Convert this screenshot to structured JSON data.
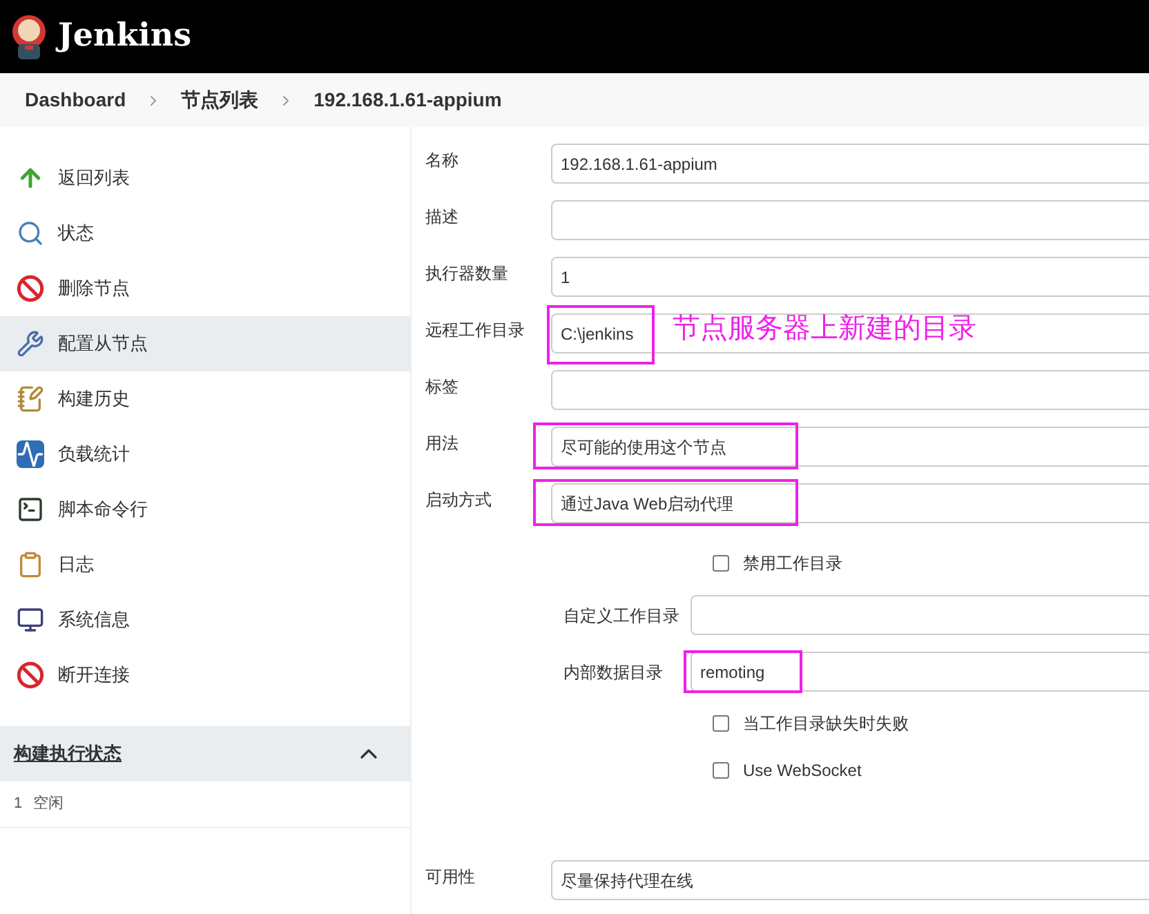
{
  "header": {
    "title": "Jenkins"
  },
  "breadcrumb": [
    "Dashboard",
    "节点列表",
    "192.168.1.61-appium"
  ],
  "sidebar": {
    "items": [
      {
        "label": "返回列表",
        "selected": false
      },
      {
        "label": "状态",
        "selected": false
      },
      {
        "label": "删除节点",
        "selected": false
      },
      {
        "label": "配置从节点",
        "selected": true
      },
      {
        "label": "构建历史",
        "selected": false
      },
      {
        "label": "负载统计",
        "selected": false
      },
      {
        "label": "脚本命令行",
        "selected": false
      },
      {
        "label": "日志",
        "selected": false
      },
      {
        "label": "系统信息",
        "selected": false
      },
      {
        "label": "断开连接",
        "selected": false
      }
    ],
    "executor_panel": {
      "title": "构建执行状态",
      "expanded": true,
      "rows": [
        {
          "number": "1",
          "status": "空闲"
        }
      ]
    }
  },
  "form": {
    "fields": [
      {
        "label": "名称",
        "value": "192.168.1.61-appium"
      },
      {
        "label": "描述"
      },
      {
        "label": "执行器数量",
        "value": "1"
      },
      {
        "label": "远程工作目录",
        "value": "C:\\jenkins",
        "highlighted": true,
        "annotation": "节点服务器上新建的目录"
      },
      {
        "label": "标签"
      },
      {
        "label": "用法",
        "value": "尽可能的使用这个节点",
        "highlighted": true
      },
      {
        "label": "启动方式",
        "value": "通过Java Web启动代理",
        "highlighted": true
      }
    ],
    "launch_options": [
      {
        "kind": "checkbox",
        "label": "禁用工作目录",
        "checked": false
      },
      {
        "kind": "field",
        "label": "自定义工作目录"
      },
      {
        "kind": "field",
        "label": "内部数据目录",
        "value": "remoting",
        "highlighted": true
      },
      {
        "kind": "checkbox",
        "label": "当工作目录缺失时失败",
        "checked": false
      },
      {
        "kind": "checkbox",
        "label": "Use WebSocket",
        "checked": false
      }
    ],
    "availability": {
      "label": "可用性",
      "value": "尽量保持代理在线"
    }
  }
}
